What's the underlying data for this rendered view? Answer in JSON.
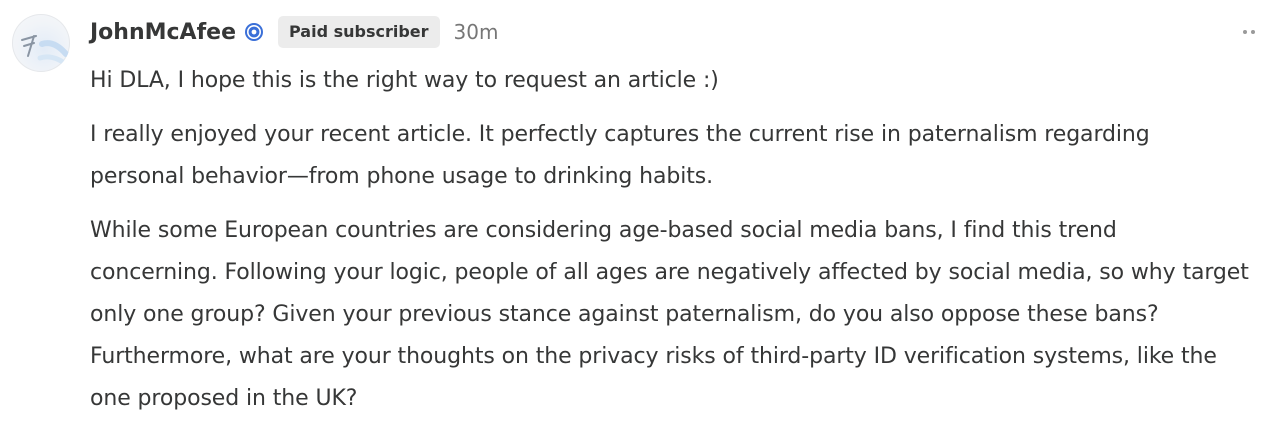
{
  "comment": {
    "author": "JohnMcAfee",
    "badge": "Paid subscriber",
    "time": "30m",
    "paragraphs": [
      "Hi DLA, I hope this is the right way to request an article :)",
      "I really enjoyed your recent article. It perfectly captures the current rise in paternalism regarding personal behavior—from phone usage to drinking habits.",
      "While some European countries are considering age-based social media bans, I find this trend concerning. Following your logic, people of all ages are negatively affected by social media, so why target only one group? Given your previous stance against paternalism, do you also oppose these bans? Furthermore, what are your thoughts on the privacy risks of third-party ID verification systems, like the one proposed in the UK?"
    ]
  },
  "icons": {
    "avatar": "user-avatar",
    "verified": "verified-badge-icon",
    "more": "more-options-icon"
  },
  "colors": {
    "text": "#363737",
    "muted": "#777777",
    "badge_bg": "#ececec",
    "verified": "#3a6fd8"
  }
}
